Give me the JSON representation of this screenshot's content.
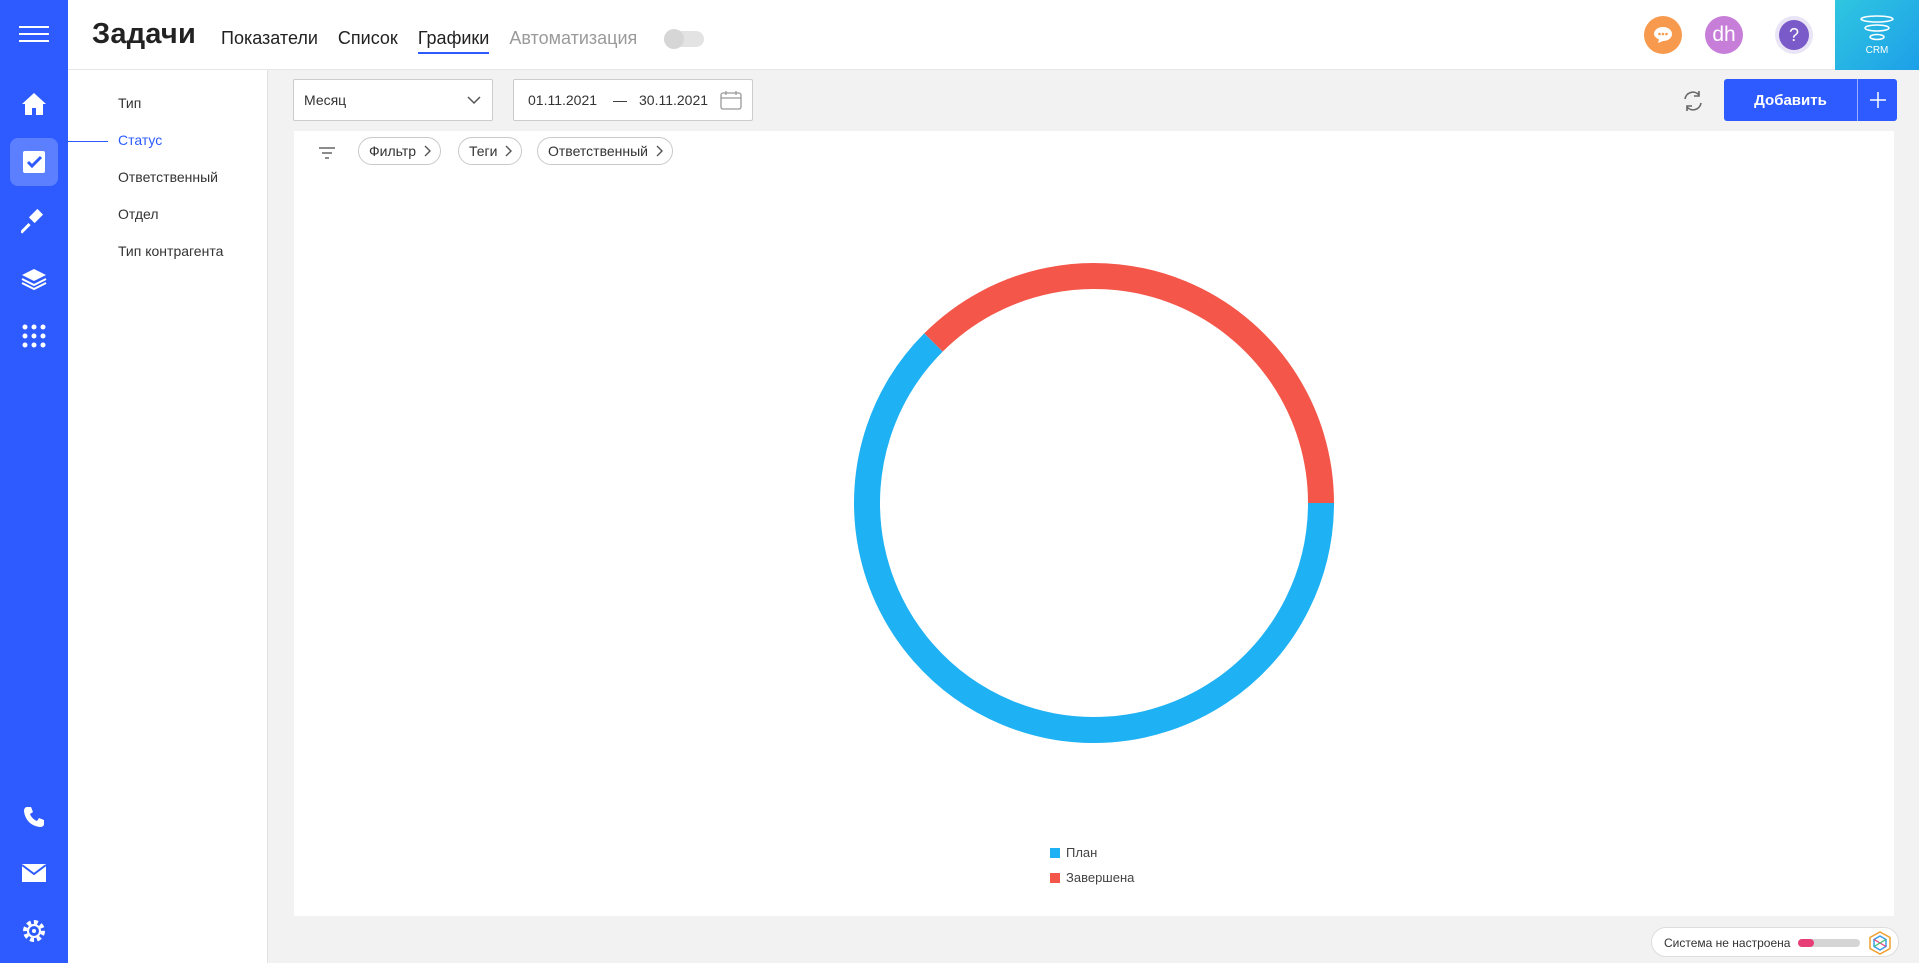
{
  "app": {
    "title": "Задачи",
    "tabs": [
      {
        "label": "Показатели",
        "state": "normal"
      },
      {
        "label": "Список",
        "state": "normal"
      },
      {
        "label": "Графики",
        "state": "active"
      },
      {
        "label": "Автоматизация",
        "state": "disabled"
      }
    ],
    "automation_toggle": "off"
  },
  "header": {
    "chat_icon": "chat-bubble-icon",
    "avatar_initials": "dh",
    "help_label": "?",
    "logo_text": "CRM",
    "accent_color": "#2e5bff"
  },
  "rail": {
    "items": [
      {
        "icon": "menu-icon"
      },
      {
        "icon": "home-icon"
      },
      {
        "icon": "tasks-icon",
        "active": true
      },
      {
        "icon": "gavel-icon"
      },
      {
        "icon": "layers-icon"
      },
      {
        "icon": "apps-grid-icon"
      },
      {
        "icon": "phone-icon"
      },
      {
        "icon": "mail-icon"
      },
      {
        "icon": "settings-icon"
      }
    ]
  },
  "sidenav": {
    "items": [
      {
        "label": "Тип"
      },
      {
        "label": "Статус",
        "active": true
      },
      {
        "label": "Ответственный"
      },
      {
        "label": "Отдел"
      },
      {
        "label": "Тип контрагента"
      }
    ]
  },
  "toolbar": {
    "period_value": "Месяц",
    "date_from": "01.11.2021",
    "date_sep": "—",
    "date_to": "30.11.2021",
    "add_label": "Добавить"
  },
  "filters": {
    "chips": [
      "Фильтр",
      "Теги",
      "Ответственный"
    ]
  },
  "chart_data": {
    "type": "pie",
    "style": "donut",
    "title": "",
    "categories": [
      "План",
      "Завершена"
    ],
    "values": [
      62.5,
      37.5
    ],
    "colors": [
      "#1eb1f3",
      "#f45649"
    ],
    "legend_position": "bottom-center"
  },
  "status": {
    "label": "Система не настроена",
    "progress": 0.25,
    "progress_color": "#e83e78"
  }
}
